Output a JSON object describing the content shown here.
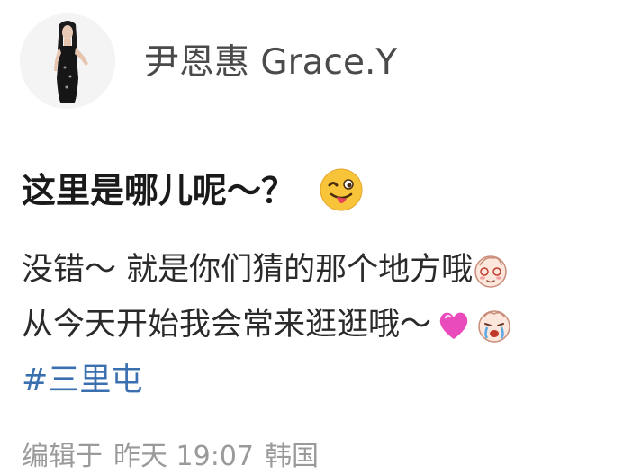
{
  "author": {
    "name": "尹恩惠 Grace.Y"
  },
  "post": {
    "headline": "这里是哪儿呢～？",
    "line1": "没错～ 就是你们猜的那个地方哦",
    "line2": "从今天开始我会常来逛逛哦～",
    "hashtag": "#三里屯",
    "emojis": [
      "winking-tongue-emoji",
      "blushing-face-emoji",
      "pink-heart-emoji",
      "crying-face-emoji"
    ]
  },
  "meta": {
    "edited": "编辑于",
    "time": "昨天 19:07",
    "location": "韩国"
  }
}
